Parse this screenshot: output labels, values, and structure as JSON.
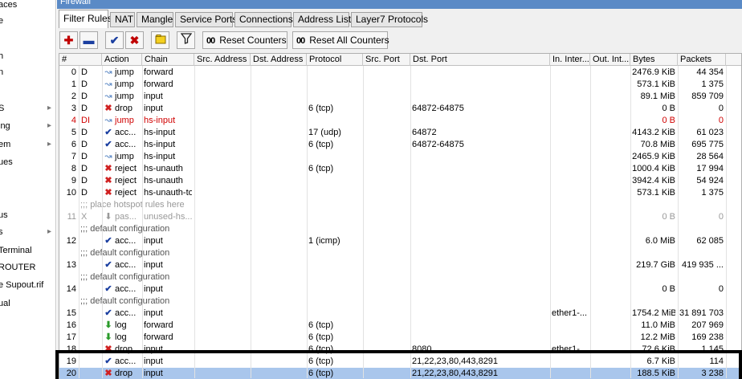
{
  "sidebar": {
    "items": [
      {
        "label": "aces",
        "arrow": false
      },
      {
        "label": "e",
        "arrow": false
      },
      {
        "label": "",
        "arrow": false
      },
      {
        "label": "h",
        "arrow": false
      },
      {
        "label": "n",
        "arrow": false
      },
      {
        "label": "",
        "arrow": false
      },
      {
        "label": "S",
        "arrow": true
      },
      {
        "label": "ing",
        "arrow": true
      },
      {
        "label": "em",
        "arrow": true
      },
      {
        "label": "ues",
        "arrow": false
      },
      {
        "label": "",
        "arrow": false
      },
      {
        "label": "",
        "arrow": false
      },
      {
        "label": "us",
        "arrow": false
      },
      {
        "label": "s",
        "arrow": true
      },
      {
        "label": "Terminal",
        "arrow": false
      },
      {
        "label": "ROUTER",
        "arrow": false
      },
      {
        "label": "e Supout.rif",
        "arrow": false
      },
      {
        "label": "ual",
        "arrow": false
      }
    ]
  },
  "window": {
    "title": "Firewall"
  },
  "tabs": [
    "Filter Rules",
    "NAT",
    "Mangle",
    "Service Ports",
    "Connections",
    "Address Lists",
    "Layer7 Protocols"
  ],
  "toolbar": {
    "reset_counters": "Reset Counters",
    "reset_all_counters": "Reset All Counters",
    "counter_glyph": "00"
  },
  "table": {
    "headers": [
      "#",
      "Action",
      "Chain",
      "Src. Address",
      "Dst. Address",
      "Protocol",
      "Src. Port",
      "Dst. Port",
      "In. Inter...",
      "Out. Int...",
      "Bytes",
      "Packets"
    ],
    "rows": [
      {
        "type": "rule",
        "num": "0",
        "flag": "D",
        "icon": "jump",
        "action": "jump",
        "chain": "forward",
        "protocol": "",
        "dst_port": "",
        "in_iface": "",
        "bytes": "2476.9 KiB",
        "packets": "44 354"
      },
      {
        "type": "rule",
        "num": "1",
        "flag": "D",
        "icon": "jump",
        "action": "jump",
        "chain": "forward",
        "protocol": "",
        "dst_port": "",
        "in_iface": "",
        "bytes": "573.1 KiB",
        "packets": "1 375"
      },
      {
        "type": "rule",
        "num": "2",
        "flag": "D",
        "icon": "jump",
        "action": "jump",
        "chain": "input",
        "protocol": "",
        "dst_port": "",
        "in_iface": "",
        "bytes": "89.1 MiB",
        "packets": "859 709"
      },
      {
        "type": "rule",
        "num": "3",
        "flag": "D",
        "icon": "drop",
        "action": "drop",
        "chain": "input",
        "protocol": "6 (tcp)",
        "dst_port": "64872-64875",
        "in_iface": "",
        "bytes": "0 B",
        "packets": "0"
      },
      {
        "type": "rule",
        "num": "4",
        "flag": "DI",
        "icon": "jump",
        "action": "jump",
        "chain": "hs-input",
        "protocol": "",
        "dst_port": "",
        "in_iface": "",
        "bytes": "0 B",
        "packets": "0",
        "style": "red"
      },
      {
        "type": "rule",
        "num": "5",
        "flag": "D",
        "icon": "accept",
        "action": "acc...",
        "chain": "hs-input",
        "protocol": "17 (udp)",
        "dst_port": "64872",
        "in_iface": "",
        "bytes": "4143.2 KiB",
        "packets": "61 023"
      },
      {
        "type": "rule",
        "num": "6",
        "flag": "D",
        "icon": "accept",
        "action": "acc...",
        "chain": "hs-input",
        "protocol": "6 (tcp)",
        "dst_port": "64872-64875",
        "in_iface": "",
        "bytes": "70.8 MiB",
        "packets": "695 775"
      },
      {
        "type": "rule",
        "num": "7",
        "flag": "D",
        "icon": "jump",
        "action": "jump",
        "chain": "hs-input",
        "protocol": "",
        "dst_port": "",
        "in_iface": "",
        "bytes": "2465.9 KiB",
        "packets": "28 564"
      },
      {
        "type": "rule",
        "num": "8",
        "flag": "D",
        "icon": "drop",
        "action": "reject",
        "chain": "hs-unauth",
        "protocol": "6 (tcp)",
        "dst_port": "",
        "in_iface": "",
        "bytes": "1000.4 KiB",
        "packets": "17 994"
      },
      {
        "type": "rule",
        "num": "9",
        "flag": "D",
        "icon": "drop",
        "action": "reject",
        "chain": "hs-unauth",
        "protocol": "",
        "dst_port": "",
        "in_iface": "",
        "bytes": "3942.4 KiB",
        "packets": "54 924"
      },
      {
        "type": "rule",
        "num": "10",
        "flag": "D",
        "icon": "drop",
        "action": "reject",
        "chain": "hs-unauth-to",
        "protocol": "",
        "dst_port": "",
        "in_iface": "",
        "bytes": "573.1 KiB",
        "packets": "1 375"
      },
      {
        "type": "comment",
        "text": ";;; place hotspot rules here",
        "style": "disabled"
      },
      {
        "type": "rule",
        "num": "11",
        "flag": "X",
        "icon": "pass",
        "action": "pas...",
        "chain": "unused-hs...",
        "protocol": "",
        "dst_port": "",
        "in_iface": "",
        "bytes": "0 B",
        "packets": "0",
        "style": "disabled"
      },
      {
        "type": "comment",
        "text": ";;; default configuration"
      },
      {
        "type": "rule",
        "num": "12",
        "flag": "",
        "icon": "accept",
        "action": "acc...",
        "chain": "input",
        "protocol": "1 (icmp)",
        "dst_port": "",
        "in_iface": "",
        "bytes": "6.0 MiB",
        "packets": "62 085"
      },
      {
        "type": "comment",
        "text": ";;; default configuration"
      },
      {
        "type": "rule",
        "num": "13",
        "flag": "",
        "icon": "accept",
        "action": "acc...",
        "chain": "input",
        "protocol": "",
        "dst_port": "",
        "in_iface": "",
        "bytes": "219.7 GiB",
        "packets": "419 935 ..."
      },
      {
        "type": "comment",
        "text": ";;; default configuration"
      },
      {
        "type": "rule",
        "num": "14",
        "flag": "",
        "icon": "accept",
        "action": "acc...",
        "chain": "input",
        "protocol": "",
        "dst_port": "",
        "in_iface": "",
        "bytes": "0 B",
        "packets": "0"
      },
      {
        "type": "comment",
        "text": ";;; default configuration"
      },
      {
        "type": "rule",
        "num": "15",
        "flag": "",
        "icon": "accept",
        "action": "acc...",
        "chain": "input",
        "protocol": "",
        "dst_port": "",
        "in_iface": "ether1-...",
        "bytes": "1754.2 MiB",
        "packets": "31 891 703"
      },
      {
        "type": "rule",
        "num": "16",
        "flag": "",
        "icon": "log",
        "action": "log",
        "chain": "forward",
        "protocol": "6 (tcp)",
        "dst_port": "",
        "in_iface": "",
        "bytes": "11.0 MiB",
        "packets": "207 969"
      },
      {
        "type": "rule",
        "num": "17",
        "flag": "",
        "icon": "log",
        "action": "log",
        "chain": "forward",
        "protocol": "6 (tcp)",
        "dst_port": "",
        "in_iface": "",
        "bytes": "12.2 MiB",
        "packets": "169 238"
      },
      {
        "type": "rule",
        "num": "18",
        "flag": "",
        "icon": "drop",
        "action": "drop",
        "chain": "input",
        "protocol": "6 (tcp)",
        "dst_port": "8080",
        "in_iface": "ether1-...",
        "bytes": "72.6 KiB",
        "packets": "1 145"
      },
      {
        "type": "rule",
        "num": "19",
        "flag": "",
        "icon": "accept",
        "action": "acc...",
        "chain": "input",
        "protocol": "6 (tcp)",
        "dst_port": "21,22,23,80,443,8291",
        "in_iface": "",
        "bytes": "6.7 KiB",
        "packets": "114"
      },
      {
        "type": "rule",
        "num": "20",
        "flag": "",
        "icon": "drop",
        "action": "drop",
        "chain": "input",
        "protocol": "6 (tcp)",
        "dst_port": "21,22,23,80,443,8291",
        "in_iface": "",
        "bytes": "188.5 KiB",
        "packets": "3 238",
        "selected": true
      }
    ]
  },
  "icons": {
    "jump": "jump-icon",
    "accept": "checkmark-icon",
    "drop": "red-x-icon",
    "log": "green-down-arrow-icon",
    "pass": "grey-down-arrow-icon"
  },
  "colors": {
    "titlebar": "#5a8ac6",
    "disabled_red": "#d00000",
    "selection": "#a9c6ec",
    "highlight_box": "#000000"
  }
}
